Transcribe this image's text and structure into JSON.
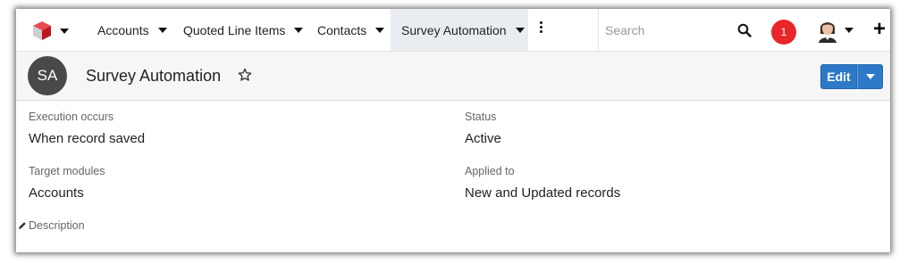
{
  "nav": {
    "items": [
      {
        "label": "Accounts",
        "active": false
      },
      {
        "label": "Quoted Line Items",
        "active": false
      },
      {
        "label": "Contacts",
        "active": false
      },
      {
        "label": "Survey Automation",
        "active": true
      }
    ],
    "search_placeholder": "Search",
    "notification_count": "1"
  },
  "record": {
    "initials": "SA",
    "title": "Survey Automation",
    "edit_label": "Edit"
  },
  "fields": {
    "execution_occurs": {
      "label": "Execution occurs",
      "value": "When record saved"
    },
    "status": {
      "label": "Status",
      "value": "Active"
    },
    "target_modules": {
      "label": "Target modules",
      "value": "Accounts"
    },
    "applied_to": {
      "label": "Applied to",
      "value": "New and Updated records"
    },
    "description": {
      "label": "Description"
    }
  },
  "colors": {
    "accent": "#2d79c8",
    "notification": "#e8262a",
    "active_tab": "#e9edf1",
    "logo_red": "#d9272e"
  },
  "icons": [
    "app-logo-icon",
    "kebab-menu-icon",
    "search-icon",
    "user-avatar-icon",
    "plus-icon",
    "star-outline-icon",
    "pencil-icon"
  ]
}
